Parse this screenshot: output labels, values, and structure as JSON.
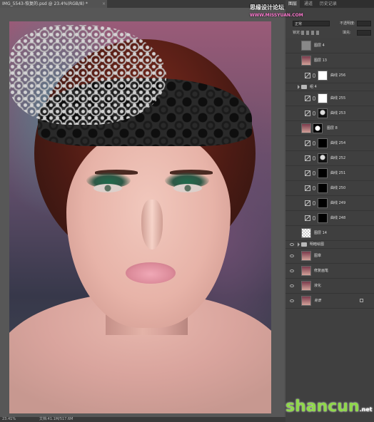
{
  "document": {
    "tab_title": "IMG_5543-恢复的.psd @ 23.4%(RGB/8) *",
    "close_label": "×"
  },
  "status": {
    "zoom": "23.41%",
    "doc_info": "文档:41.1M/517.6M"
  },
  "panel": {
    "tabs": [
      "图层",
      "通道",
      "历史记录"
    ],
    "blend_mode": "正常",
    "opacity_label": "不透明度:",
    "lock_label": "锁定:",
    "fill_label": "填充:"
  },
  "layers": [
    {
      "type": "pixel",
      "thumb": "gray",
      "name": "图层 4"
    },
    {
      "type": "pixel",
      "thumb": "photo",
      "name": "图层 13"
    },
    {
      "type": "adjustment",
      "mask": "white",
      "name": "曲线 256"
    },
    {
      "type": "group",
      "name": "组 4"
    },
    {
      "type": "adjustment",
      "mask": "white",
      "name": "曲线 255"
    },
    {
      "type": "adjustment",
      "mask": "dark",
      "name": "曲线 253"
    },
    {
      "type": "pixel-mask",
      "thumb": "photo",
      "name": "图层 8"
    },
    {
      "type": "adjustment",
      "mask": "black",
      "name": "曲线 254"
    },
    {
      "type": "adjustment",
      "mask": "dark",
      "name": "曲线 252"
    },
    {
      "type": "adjustment",
      "mask": "black",
      "name": "曲线 251"
    },
    {
      "type": "adjustment",
      "mask": "black",
      "name": "曲线 250"
    },
    {
      "type": "adjustment",
      "mask": "black",
      "name": "曲线 249"
    },
    {
      "type": "adjustment",
      "mask": "black",
      "name": "曲线 248"
    },
    {
      "type": "pixel",
      "thumb": "check",
      "name": "图层 14"
    },
    {
      "type": "group",
      "name": "明暗绘图"
    },
    {
      "type": "pixel",
      "thumb": "photo",
      "name": "图章"
    },
    {
      "type": "pixel",
      "thumb": "photo",
      "name": "修复画笔"
    },
    {
      "type": "pixel",
      "thumb": "photo",
      "name": "液化"
    },
    {
      "type": "background",
      "thumb": "photo",
      "name": "背景"
    }
  ],
  "watermark": {
    "top": "思缘设计论坛",
    "top_sub": "WWW.MISSYUAN.COM",
    "bottom": "shancun",
    "bottom_net": ".net"
  },
  "colors": {
    "panel_bg": "#404040",
    "canvas_bg": "#575757",
    "accent_green": "#8fd84a"
  }
}
